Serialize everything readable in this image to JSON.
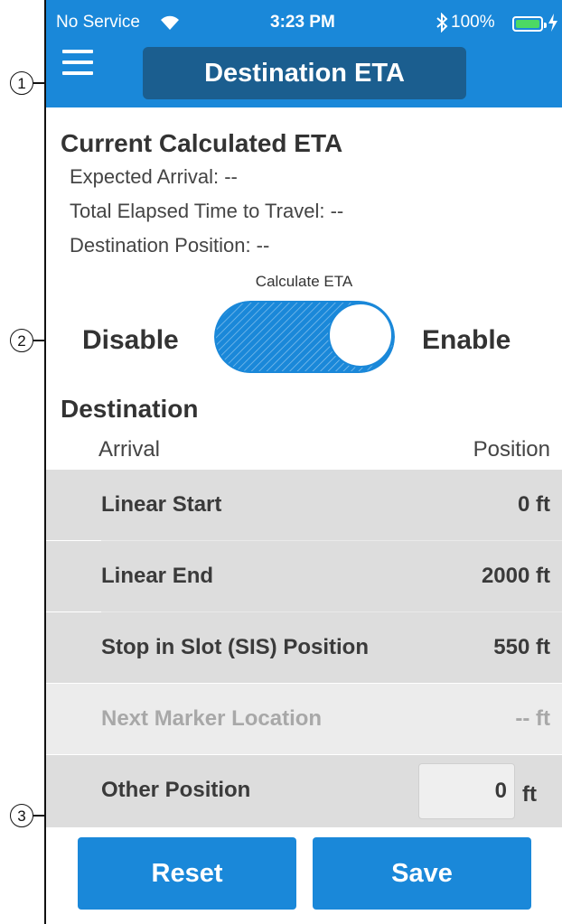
{
  "status_bar": {
    "carrier": "No Service",
    "time": "3:23 PM",
    "battery": "100%",
    "battery_level": 1.0
  },
  "header": {
    "title": "Destination ETA",
    "menu_icon": "hamburger-menu-icon",
    "accent_color": "#1a88d9"
  },
  "eta": {
    "heading": "Current Calculated ETA",
    "expected_arrival": "Expected Arrival: --",
    "elapsed": "Total Elapsed Time to Travel: --",
    "position": "Destination Position: --"
  },
  "toggle": {
    "caption": "Calculate ETA",
    "off_label": "Disable",
    "on_label": "Enable",
    "state": "on"
  },
  "destination": {
    "heading": "Destination",
    "col_left": "Arrival",
    "col_right": "Position",
    "rows": [
      {
        "label": "Linear Start",
        "value": "0 ft",
        "enabled": true
      },
      {
        "label": "Linear End",
        "value": "2000 ft",
        "enabled": true
      },
      {
        "label": "Stop in Slot (SIS) Position",
        "value": "550 ft",
        "enabled": true
      },
      {
        "label": "Next Marker Location",
        "value": "-- ft",
        "enabled": false
      }
    ],
    "other": {
      "label": "Other Position",
      "value": "0",
      "unit": "ft"
    }
  },
  "buttons": {
    "reset": "Reset",
    "save": "Save"
  },
  "callouts": [
    "1",
    "2",
    "3"
  ]
}
